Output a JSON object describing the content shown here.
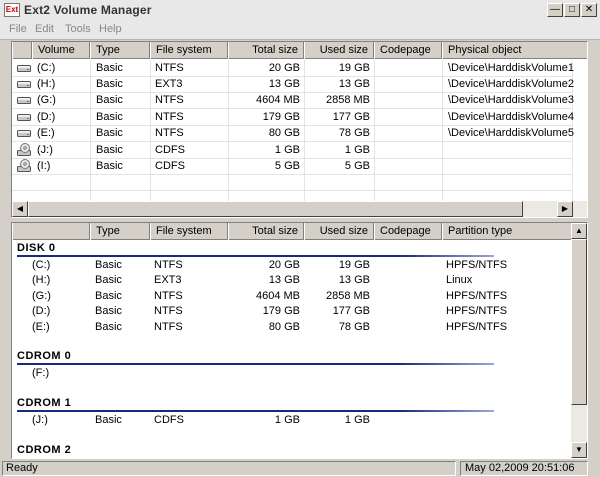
{
  "window": {
    "title": "Ext2 Volume Manager",
    "icon_text": "Ext"
  },
  "menu": [
    "File",
    "Edit",
    "Tools",
    "Help"
  ],
  "volumes_table": {
    "columns": [
      "Volume",
      "Type",
      "File system",
      "Total size",
      "Used size",
      "Codepage",
      "Physical object"
    ],
    "rows": [
      {
        "icon": "hard-disk-icon",
        "volume": "(C:)",
        "type": "Basic",
        "fs": "NTFS",
        "total": "20 GB",
        "used": "19 GB",
        "codepage": "",
        "physical": "\\Device\\HarddiskVolume1"
      },
      {
        "icon": "hard-disk-icon",
        "volume": "(H:)",
        "type": "Basic",
        "fs": "EXT3",
        "total": "13 GB",
        "used": "13 GB",
        "codepage": "",
        "physical": "\\Device\\HarddiskVolume2"
      },
      {
        "icon": "hard-disk-icon",
        "volume": "(G:)",
        "type": "Basic",
        "fs": "NTFS",
        "total": "4604 MB",
        "used": "2858 MB",
        "codepage": "",
        "physical": "\\Device\\HarddiskVolume3"
      },
      {
        "icon": "hard-disk-icon",
        "volume": "(D:)",
        "type": "Basic",
        "fs": "NTFS",
        "total": "179 GB",
        "used": "177 GB",
        "codepage": "",
        "physical": "\\Device\\HarddiskVolume4"
      },
      {
        "icon": "hard-disk-icon",
        "volume": "(E:)",
        "type": "Basic",
        "fs": "NTFS",
        "total": "80 GB",
        "used": "78 GB",
        "codepage": "",
        "physical": "\\Device\\HarddiskVolume5"
      },
      {
        "icon": "cdrom-icon",
        "volume": "(J:)",
        "type": "Basic",
        "fs": "CDFS",
        "total": "1 GB",
        "used": "1 GB",
        "codepage": "",
        "physical": ""
      },
      {
        "icon": "cdrom-icon",
        "volume": "(I:)",
        "type": "Basic",
        "fs": "CDFS",
        "total": "5 GB",
        "used": "5 GB",
        "codepage": "",
        "physical": ""
      }
    ]
  },
  "disks_table": {
    "columns": [
      "",
      "Type",
      "File system",
      "Total size",
      "Used size",
      "Codepage",
      "Partition type"
    ],
    "groups": [
      {
        "name": "DISK 0",
        "rows": [
          {
            "volume": "(C:)",
            "type": "Basic",
            "fs": "NTFS",
            "total": "20 GB",
            "used": "19 GB",
            "codepage": "",
            "partition": "HPFS/NTFS"
          },
          {
            "volume": "(H:)",
            "type": "Basic",
            "fs": "EXT3",
            "total": "13 GB",
            "used": "13 GB",
            "codepage": "",
            "partition": "Linux"
          },
          {
            "volume": "(G:)",
            "type": "Basic",
            "fs": "NTFS",
            "total": "4604 MB",
            "used": "2858 MB",
            "codepage": "",
            "partition": "HPFS/NTFS"
          },
          {
            "volume": "(D:)",
            "type": "Basic",
            "fs": "NTFS",
            "total": "179 GB",
            "used": "177 GB",
            "codepage": "",
            "partition": "HPFS/NTFS"
          },
          {
            "volume": "(E:)",
            "type": "Basic",
            "fs": "NTFS",
            "total": "80 GB",
            "used": "78 GB",
            "codepage": "",
            "partition": "HPFS/NTFS"
          }
        ]
      },
      {
        "name": "CDROM 0",
        "rows": [
          {
            "volume": "(F:)",
            "type": "",
            "fs": "",
            "total": "",
            "used": "",
            "codepage": "",
            "partition": ""
          }
        ]
      },
      {
        "name": "CDROM 1",
        "rows": [
          {
            "volume": "(J:)",
            "type": "Basic",
            "fs": "CDFS",
            "total": "1 GB",
            "used": "1 GB",
            "codepage": "",
            "partition": ""
          }
        ]
      },
      {
        "name": "CDROM 2",
        "rows": []
      }
    ]
  },
  "status": {
    "left": "Ready",
    "right": "May 02,2009 20:51:06"
  }
}
